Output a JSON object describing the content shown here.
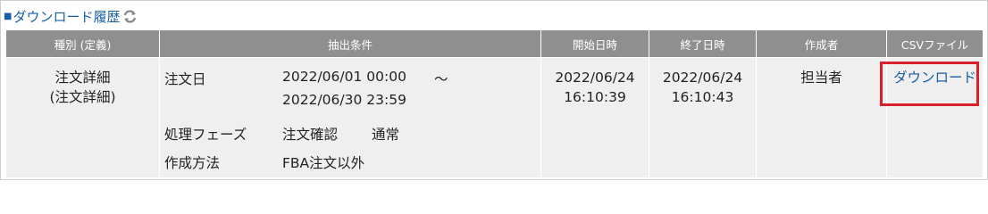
{
  "section": {
    "title": "ダウンロード履歴",
    "marker": "■",
    "refresh_icon": "refresh-icon"
  },
  "table": {
    "headers": {
      "type": "種別 (定義)",
      "conditions": "抽出条件",
      "start_time": "開始日時",
      "end_time": "終了日時",
      "creator": "作成者",
      "csv": "CSVファイル"
    },
    "row": {
      "type_line1": "注文詳細",
      "type_line2": "(注文詳細)",
      "cond_order_date_label": "注文日",
      "cond_order_date_from": "2022/06/01 00:00",
      "cond_order_date_sep": "～",
      "cond_order_date_to": "2022/06/30 23:59",
      "cond_phase_label": "処理フェーズ",
      "cond_phase_value1": "注文確認",
      "cond_phase_value2": "通常",
      "cond_method_label": "作成方法",
      "cond_method_value": "FBA注文以外",
      "start_date": "2022/06/24",
      "start_time": "16:10:39",
      "end_date": "2022/06/24",
      "end_time": "16:10:43",
      "creator": "担当者",
      "csv_link": "ダウンロード"
    }
  },
  "colors": {
    "link": "#1a5fa3",
    "header_bg": "#8f8f8f",
    "row_bg": "#efefef",
    "highlight": "#d9202c"
  }
}
